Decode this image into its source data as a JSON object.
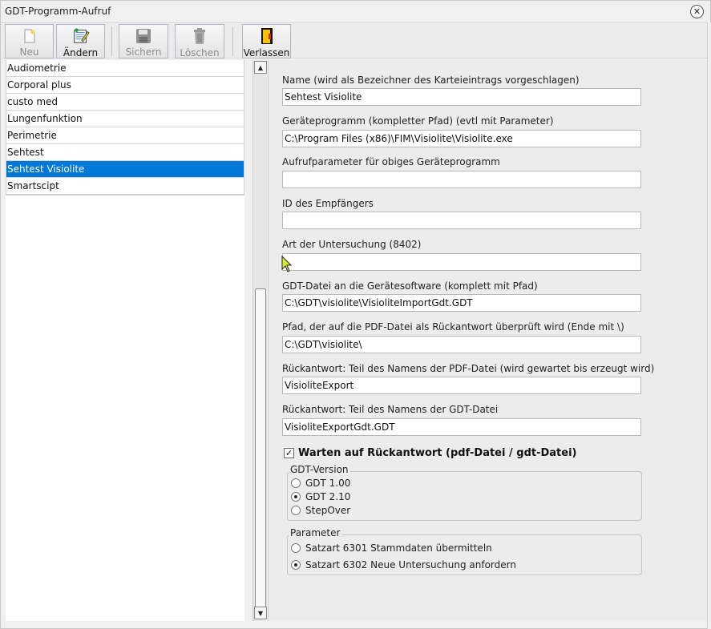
{
  "window": {
    "title": "GDT-Programm-Aufruf"
  },
  "toolbar": {
    "buttons": [
      {
        "label": "Neu",
        "icon": "new-document-icon",
        "enabled": false
      },
      {
        "label": "Ändern",
        "icon": "edit-document-icon",
        "enabled": true
      },
      {
        "label": "Sichern",
        "icon": "save-disk-icon",
        "enabled": false
      },
      {
        "label": "Löschen",
        "icon": "trash-icon",
        "enabled": false
      },
      {
        "label": "Verlassen",
        "icon": "exit-door-icon",
        "enabled": true
      }
    ]
  },
  "list": {
    "items": [
      "Audiometrie",
      "Corporal plus",
      "custo med",
      "Lungenfunktion",
      "Perimetrie",
      "Sehtest",
      "Sehtest Visiolite",
      "Smartscipt"
    ],
    "selected": "Sehtest Visiolite"
  },
  "form": {
    "fields": [
      {
        "label": "Name (wird als Bezeichner des Karteieintrags vorgeschlagen)",
        "value": "Sehtest Visiolite"
      },
      {
        "label": "Geräteprogramm (kompletter Pfad) (evtl mit Parameter)",
        "value": "C:\\Program Files (x86)\\FIM\\Visiolite\\Visiolite.exe"
      },
      {
        "label": "Aufrufparameter für obiges Geräteprogramm",
        "value": ""
      },
      {
        "label": "ID des Empfängers",
        "value": ""
      },
      {
        "label": "Art der Untersuchung (8402)",
        "value": ""
      },
      {
        "label": "GDT-Datei an die Gerätesoftware (komplett mit Pfad)",
        "value": "C:\\GDT\\visiolite\\VisioliteImportGdt.GDT"
      },
      {
        "label": "Pfad, der auf die PDF-Datei als Rückantwort überprüft wird (Ende mit \\)",
        "value": "C:\\GDT\\visiolite\\"
      },
      {
        "label": "Rückantwort: Teil des Namens der PDF-Datei (wird gewartet bis erzeugt wird)",
        "value": "VisioliteExport"
      },
      {
        "label": "Rückantwort: Teil des Namens der GDT-Datei",
        "value": "VisioliteExportGdt.GDT"
      }
    ],
    "wait_checkbox": {
      "label": "Warten auf Rückantwort (pdf-Datei / gdt-Datei)",
      "checked": true
    },
    "gdt_version": {
      "title": "GDT-Version",
      "options": [
        "GDT 1.00",
        "GDT 2.10",
        "StepOver"
      ],
      "selected": "GDT 2.10"
    },
    "parameter": {
      "title": "Parameter",
      "options": [
        "Satzart 6301 Stammdaten übermitteln",
        "Satzart 6302 Neue Untersuchung anfordern"
      ],
      "selected": "Satzart 6302 Neue Untersuchung anfordern"
    }
  },
  "colors": {
    "selection": "#0078d7",
    "pane_background": "#ececec",
    "window_background": "#f0f0f0"
  }
}
